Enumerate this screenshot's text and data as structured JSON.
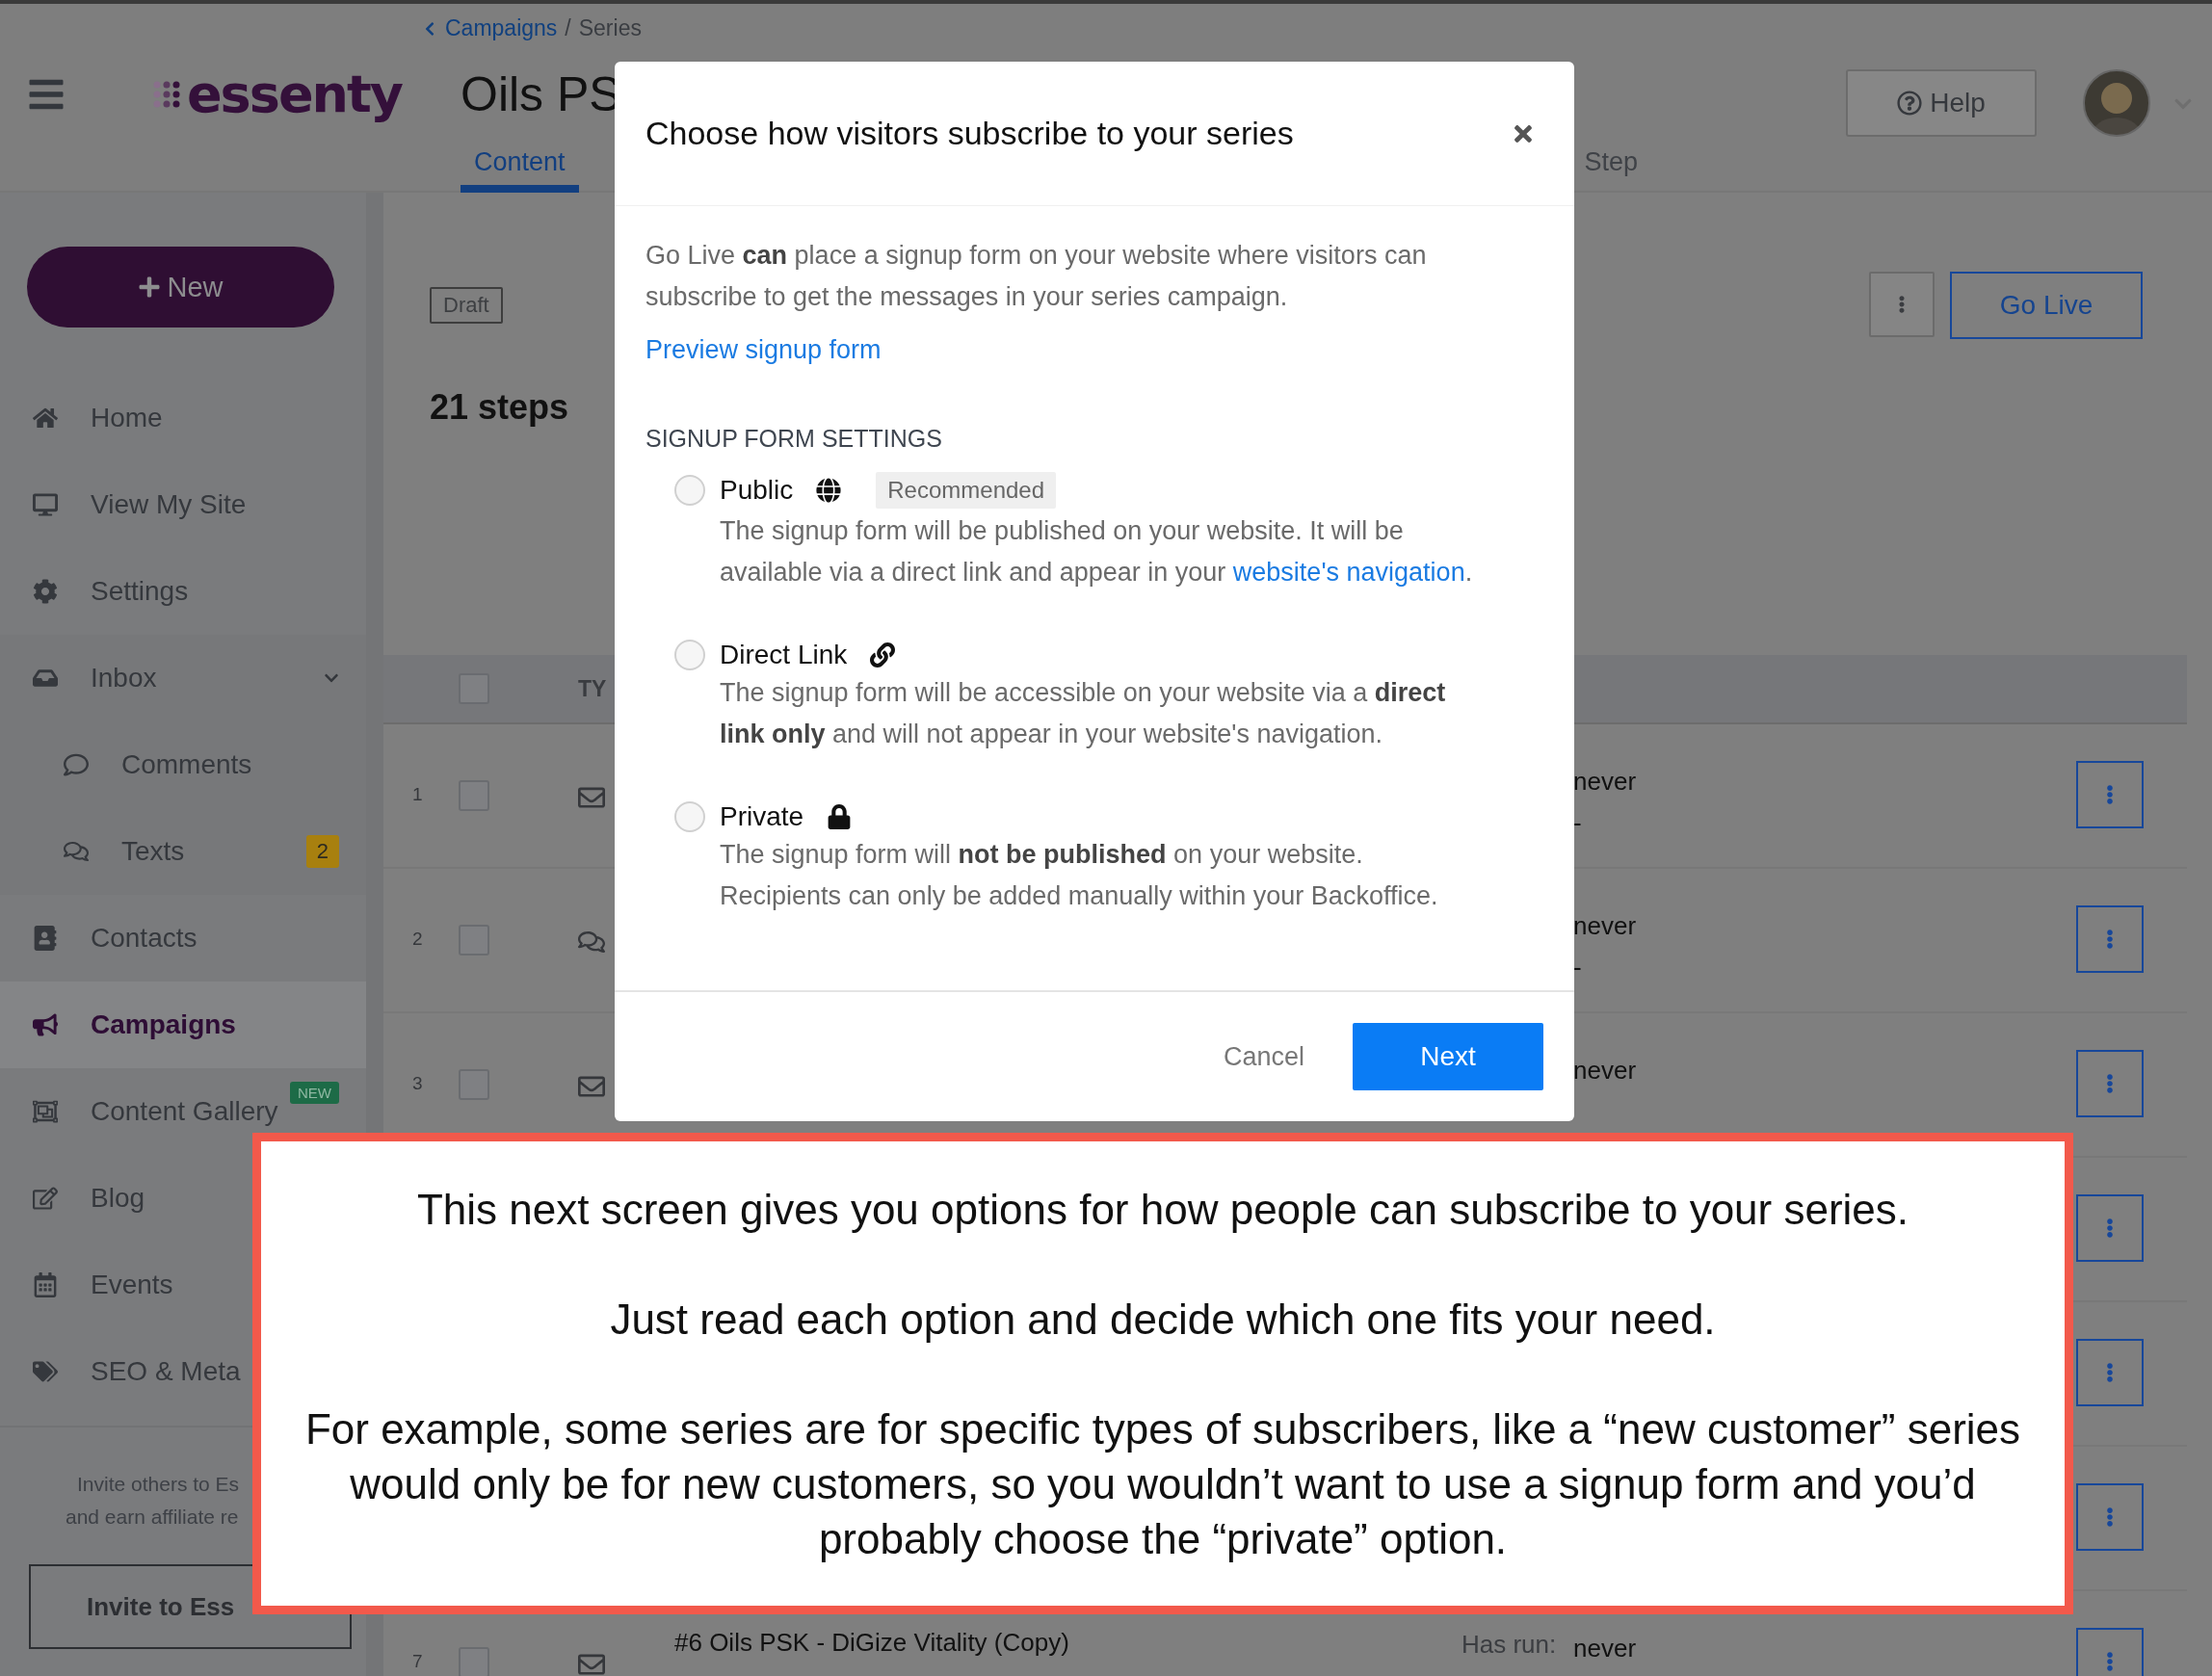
{
  "header": {
    "logo": "essenty",
    "breadcrumb": {
      "link": "Campaigns",
      "separator": "/",
      "current": "Series"
    },
    "title": "Oils PS",
    "tabs": [
      {
        "label": "Content",
        "selected": true
      },
      {
        "label": "Step",
        "selected": false
      }
    ],
    "help_button": "Help"
  },
  "sidebar": {
    "new_button": "New",
    "items": [
      {
        "label": "Home",
        "selected": false
      },
      {
        "label": "View My Site",
        "selected": false
      },
      {
        "label": "Settings",
        "selected": false
      },
      {
        "label": "Inbox",
        "selected": false,
        "expanded": true,
        "children": [
          {
            "label": "Comments",
            "selected": false
          },
          {
            "label": "Texts",
            "selected": false,
            "badge": {
              "text": "2",
              "kind": "count"
            }
          }
        ]
      },
      {
        "label": "Contacts",
        "selected": false
      },
      {
        "label": "Campaigns",
        "selected": true
      },
      {
        "label": "Content Gallery",
        "selected": false,
        "badge": {
          "text": "NEW",
          "kind": "new"
        }
      },
      {
        "label": "Blog",
        "selected": false
      },
      {
        "label": "Events",
        "selected": false
      },
      {
        "label": "SEO & Meta",
        "selected": false
      }
    ],
    "invite_text": [
      "Invite others to Es",
      "and earn affiliate re"
    ],
    "invite_button": "Invite to Ess"
  },
  "series": {
    "status": "Draft",
    "steps_title": "21 steps",
    "go_live_button": "Go Live"
  },
  "table": {
    "header": {
      "checked": false,
      "column_type": "TY"
    },
    "rows": [
      {
        "kind": "email",
        "number": "1",
        "checked": false,
        "run_value": "never",
        "last_run_value": "-"
      },
      {
        "kind": "text",
        "number": "2",
        "checked": false,
        "run_value": "never",
        "last_run_value": "-"
      },
      {
        "kind": "email",
        "number": "3",
        "checked": false,
        "run_value": "never"
      },
      {
        "kind": "covered"
      },
      {
        "kind": "covered"
      },
      {
        "kind": "covered"
      },
      {
        "kind": "email",
        "number": "7",
        "checked": false,
        "title": "#6 Oils PSK - DiGize Vitality (Copy)",
        "run_label": "Has run:",
        "run_value": "never"
      }
    ]
  },
  "modal": {
    "title": "Choose how visitors subscribe to your series",
    "intro": "Go Live **can** place a signup form on your website where visitors can subscribe to get the messages in your series campaign.",
    "preview_link": "Preview signup form",
    "settings_heading": "SIGNUP FORM SETTINGS",
    "options": [
      {
        "label": "Public",
        "selected": false,
        "tag": "Recommended",
        "description": "The signup form will be published on your website. It will be available via a direct link and appear in your",
        "link": "website's navigation",
        "description_end": "."
      },
      {
        "label": "Direct Link",
        "selected": false,
        "description": "The signup form will be accessible on your website via a **direct link only** and will not appear in your website's navigation."
      },
      {
        "label": "Private",
        "selected": false,
        "description": "The signup form will **not be published** on your website. Recipients can only be added manually within your Backoffice."
      }
    ],
    "cancel_button": "Cancel",
    "next_button": "Next"
  },
  "callout": {
    "paragraphs": [
      "This next screen gives you options for how people can subscribe to your series.",
      "Just read each option and decide which one fits your need.",
      "For example, some series are for specific types of subscribers, like a “new customer” series would only be for new customers, so you wouldn’t want to use a signup form and you’d probably choose the “private” option."
    ]
  }
}
